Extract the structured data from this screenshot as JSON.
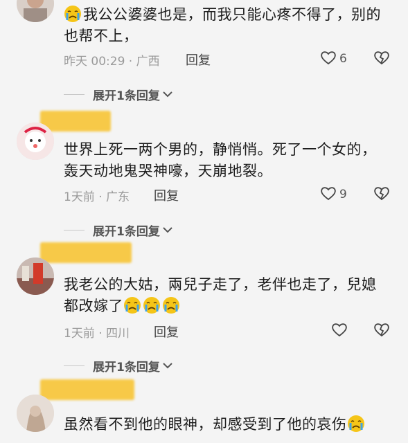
{
  "comments": [
    {
      "text": "我公公婆婆也是，而我只能心疼不得了，别的也帮不上，",
      "time": "昨天 00:29 · 广西",
      "reply_label": "回复",
      "like_count": "6",
      "expand_label": "展开1条回复"
    },
    {
      "text": "世界上死一两个男的，静悄悄。死了一个女的，轰天动地鬼哭神嚎，天崩地裂。",
      "time": "1天前 · 广东",
      "reply_label": "回复",
      "like_count": "9",
      "expand_label": "展开1条回复"
    },
    {
      "text": "我老公的大姑，兩兒子走了，老伴也走了，兒媳都改嫁了",
      "time": "1天前 · 四川",
      "reply_label": "回复",
      "like_count": "",
      "expand_label": "展开1条回复"
    },
    {
      "text": "虽然看不到他的眼神，却感受到了他的哀伤"
    }
  ],
  "icons": {
    "like": "heart-outline-icon",
    "dislike": "broken-heart-icon",
    "expand": "chevron-down-icon",
    "emoji": "crying-face-emoji"
  },
  "colors": {
    "name_highlight": "#f7c948",
    "emoji_face": "#f5c518",
    "tear": "#3fa3e6"
  }
}
